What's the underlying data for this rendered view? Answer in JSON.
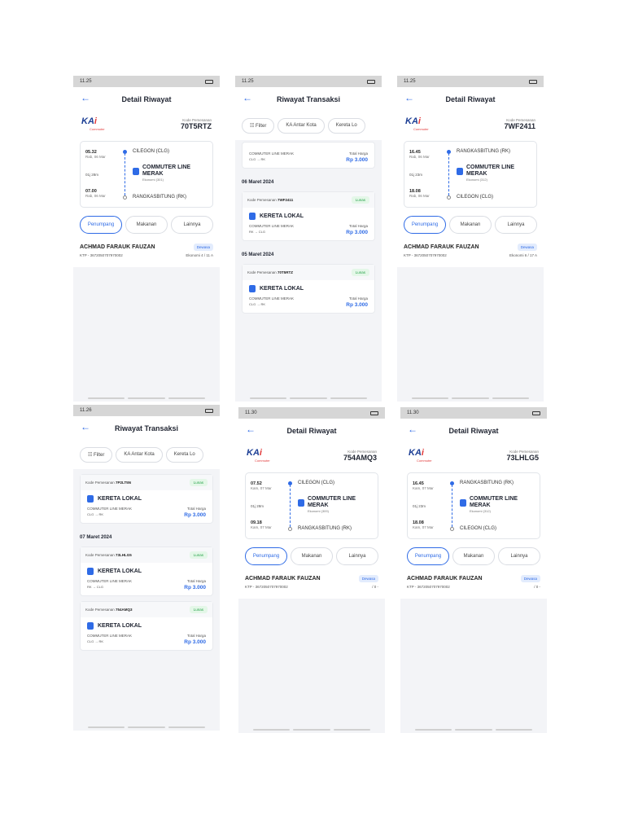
{
  "status_time": [
    "11.25",
    "11.25",
    "11.25",
    "11.26",
    "11.30",
    "11.30"
  ],
  "s1": {
    "title": "Detail Riwayat",
    "code_label": "Kode Pemesanan",
    "code": "70T5RTZ",
    "dep_time": "05.32",
    "dep_date": "Rab, 06 Mar",
    "dep_station": "CILEGON (CLG)",
    "duration": "01j 28m",
    "train": "COMMUTER LINE MERAK",
    "class": "Ekonomi (301)",
    "arr_time": "07.00",
    "arr_date": "Rab, 06 Mar",
    "arr_station": "RANGKASBITUNG (RK)",
    "tabs": [
      "Penumpang",
      "Makanan",
      "Lainnya"
    ],
    "pax_name": "ACHMAD FARAUK FAUZAN",
    "pax_type": "Dewasa",
    "ktp": "KTP - 3672050707970002",
    "seat": "Ekonomi 4 / 11 A"
  },
  "s2": {
    "title": "Riwayat Transaksi",
    "filters": [
      "Filter",
      "KA Antar Kota",
      "Kereta Lo"
    ],
    "partial_route": "COMMUTER LINE MERAK",
    "partial_codes": "CLG → RK",
    "total_label": "Total Harga",
    "partial_price": "Rp 3.000",
    "date1": "06 Maret 2024",
    "date2": "05 Maret 2024",
    "cards": [
      {
        "code_label": "Kode Pemesanan",
        "code": "7WF2411",
        "status": "Lunas",
        "train": "KERETA LOKAL",
        "route": "COMMUTER LINE MERAK",
        "codes": "RK → CLG",
        "total": "Total Harga",
        "price": "Rp 3.000"
      },
      {
        "code_label": "Kode Pemesanan",
        "code": "70T5RTZ",
        "status": "Lunas",
        "train": "KERETA LOKAL",
        "route": "COMMUTER LINE MERAK",
        "codes": "CLG → RK",
        "total": "Total Harga",
        "price": "Rp 3.000"
      }
    ]
  },
  "s3": {
    "title": "Detail Riwayat",
    "code_label": "Kode Pemesanan",
    "code": "7WF2411",
    "dep_time": "16.45",
    "dep_date": "Rab, 06 Mar",
    "dep_station": "RANGKASBITUNG (RK)",
    "duration": "01j 23m",
    "train": "COMMUTER LINE MERAK",
    "class": "Ekonomi (312)",
    "arr_time": "18.08",
    "arr_date": "Rab, 06 Mar",
    "arr_station": "CILEGON (CLG)",
    "tabs": [
      "Penumpang",
      "Makanan",
      "Lainnya"
    ],
    "pax_name": "ACHMAD FARAUK FAUZAN",
    "pax_type": "Dewasa",
    "ktp": "KTP - 3672050707970002",
    "seat": "Ekonomi 6 / 17 A"
  },
  "s4": {
    "title": "Riwayat Transaksi",
    "filters": [
      "Filter",
      "KA Antar Kota",
      "Kereta Lo"
    ],
    "date1": "07 Maret 2024",
    "cards": [
      {
        "code_label": "Kode Pemesanan",
        "code": "7P2LT5N",
        "status": "Lunas",
        "train": "KERETA LOKAL",
        "route": "COMMUTER LINE MERAK",
        "codes": "CLG → RK",
        "total": "Total Harga",
        "price": "Rp 3.000"
      },
      {
        "code_label": "Kode Pemesanan",
        "code": "73LHLG5",
        "status": "Lunas",
        "train": "KERETA LOKAL",
        "route": "COMMUTER LINE MERAK",
        "codes": "RK → CLG",
        "total": "Total Harga",
        "price": "Rp 3.000"
      },
      {
        "code_label": "Kode Pemesanan",
        "code": "754AMQ3",
        "status": "Lunas",
        "train": "KERETA LOKAL",
        "route": "COMMUTER LINE MERAK",
        "codes": "CLG → RK",
        "total": "Total Harga",
        "price": "Rp 3.000"
      }
    ]
  },
  "s5": {
    "title": "Detail Riwayat",
    "code_label": "Kode Pemesanan",
    "code": "754AMQ3",
    "dep_time": "07.52",
    "dep_date": "Kam, 07 Mar",
    "dep_station": "CILEGON (CLG)",
    "duration": "01j 28m",
    "train": "COMMUTER LINE MERAK",
    "class": "Ekonomi (309)",
    "arr_time": "09.18",
    "arr_date": "Kam, 07 Mar",
    "arr_station": "RANGKASBITUNG (RK)",
    "tabs": [
      "Penumpang",
      "Makanan",
      "Lainnya"
    ],
    "pax_name": "ACHMAD FARAUK FAUZAN",
    "pax_type": "Dewasa",
    "ktp": "KTP - 3672050707970002",
    "seat": "/ 0 -"
  },
  "s6": {
    "title": "Detail Riwayat",
    "code_label": "Kode Pemesanan",
    "code": "73LHLG5",
    "dep_time": "16.45",
    "dep_date": "Kam, 07 Mar",
    "dep_station": "RANGKASBITUNG (RK)",
    "duration": "01j 23m",
    "train": "COMMUTER LINE MERAK",
    "class": "Ekonomi (312)",
    "arr_time": "18.08",
    "arr_date": "Kam, 07 Mar",
    "arr_station": "CILEGON (CLG)",
    "tabs": [
      "Penumpang",
      "Makanan",
      "Lainnya"
    ],
    "pax_name": "ACHMAD FARAUK FAUZAN",
    "pax_type": "Dewasa",
    "ktp": "KTP - 3672050707970002",
    "seat": "/ 0 -"
  }
}
